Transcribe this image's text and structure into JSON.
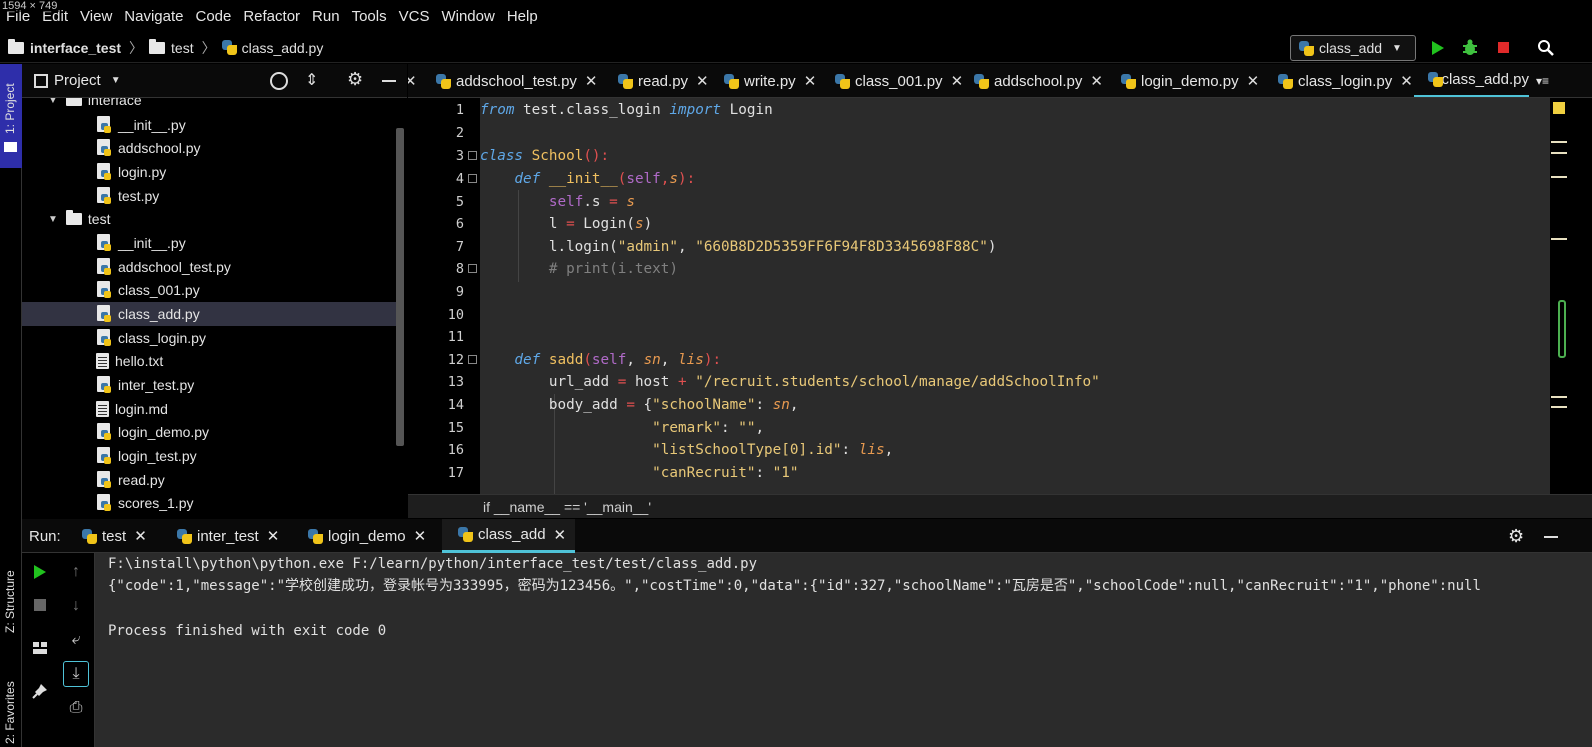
{
  "screen_label": "1594 × 749",
  "menu": [
    "File",
    "Edit",
    "View",
    "Navigate",
    "Code",
    "Refactor",
    "Run",
    "Tools",
    "VCS",
    "Window",
    "Help"
  ],
  "nav": {
    "project": "interface_test",
    "folder": "test",
    "file": "class_add.py"
  },
  "run_config": "class_add",
  "side_tabs": {
    "project": "1: Project",
    "structure": "Z: Structure",
    "favorites": "2: Favorites"
  },
  "project_panel": {
    "title": "Project",
    "tree": [
      {
        "label": "interface",
        "type": "folder",
        "expanded": true
      },
      {
        "label": "__init__.py",
        "type": "py"
      },
      {
        "label": "addschool.py",
        "type": "py"
      },
      {
        "label": "login.py",
        "type": "py"
      },
      {
        "label": "test.py",
        "type": "py"
      },
      {
        "label": "test",
        "type": "folder",
        "expanded": true
      },
      {
        "label": "__init__.py",
        "type": "py"
      },
      {
        "label": "addschool_test.py",
        "type": "py"
      },
      {
        "label": "class_001.py",
        "type": "py"
      },
      {
        "label": "class_add.py",
        "type": "py",
        "selected": true
      },
      {
        "label": "class_login.py",
        "type": "py"
      },
      {
        "label": "hello.txt",
        "type": "txt"
      },
      {
        "label": "inter_test.py",
        "type": "py"
      },
      {
        "label": "login.md",
        "type": "txt"
      },
      {
        "label": "login_demo.py",
        "type": "py"
      },
      {
        "label": "login_test.py",
        "type": "py"
      },
      {
        "label": "read.py",
        "type": "py"
      },
      {
        "label": "scores_1.py",
        "type": "py"
      }
    ]
  },
  "editor_tabs": [
    "addschool_test.py",
    "read.py",
    "write.py",
    "class_001.py",
    "addschool.py",
    "login_demo.py",
    "class_login.py",
    "class_add.py"
  ],
  "active_editor_tab": "class_add.py",
  "line_numbers": [
    "1",
    "2",
    "3",
    "4",
    "5",
    "6",
    "7",
    "8",
    "9",
    "10",
    "11",
    "12",
    "13",
    "14",
    "15",
    "16",
    "17"
  ],
  "code": {
    "l1_a": "from",
    "l1_b": " test.class_login ",
    "l1_c": "import",
    "l1_d": " Login",
    "l3_a": "class",
    "l3_b": " School",
    "l3_c": "():",
    "l4_a": "    def",
    "l4_b": " __init__",
    "l4_c": "(",
    "l4_d": "self",
    "l4_e": ",",
    "l4_f": "s",
    "l4_g": "):",
    "l5_a": "        ",
    "l5_b": "self",
    "l5_c": ".s ",
    "l5_d": "=",
    "l5_e": " ",
    "l5_f": "s",
    "l6_a": "        l ",
    "l6_b": "=",
    "l6_c": " Login(",
    "l6_d": "s",
    "l6_e": ")",
    "l7_a": "        l.login(",
    "l7_b": "\"admin\"",
    "l7_c": ", ",
    "l7_d": "\"660B8D2D5359FF6F94F8D3345698F88C\"",
    "l7_e": ")",
    "l8": "        # print(i.text)",
    "l12_a": "    def",
    "l12_b": " sadd",
    "l12_c": "(",
    "l12_d": "self",
    "l12_e": ", ",
    "l12_f": "sn",
    "l12_g": ", ",
    "l12_h": "lis",
    "l12_i": "):",
    "l13_a": "        url_add ",
    "l13_b": "=",
    "l13_c": " host ",
    "l13_d": "+",
    "l13_e": " ",
    "l13_f": "\"/recruit.students/school/manage/addSchoolInfo\"",
    "l14_a": "        body_add ",
    "l14_b": "=",
    "l14_c": " {",
    "l14_d": "\"schoolName\"",
    "l14_e": ": ",
    "l14_f": "sn",
    "l14_g": ",",
    "l15_a": "                    ",
    "l15_b": "\"remark\"",
    "l15_c": ": ",
    "l15_d": "\"\"",
    "l15_e": ",",
    "l16_a": "                    ",
    "l16_b": "\"listSchoolType[0].id\"",
    "l16_c": ": ",
    "l16_d": "lis",
    "l16_e": ",",
    "l17_a": "                    ",
    "l17_b": "\"canRecruit\"",
    "l17_c": ": ",
    "l17_d": "\"1\""
  },
  "editor_breadcrumb": "if __name__ == '__main__'",
  "run_panel": {
    "label": "Run:",
    "tabs": [
      "test",
      "inter_test",
      "login_demo",
      "class_add"
    ],
    "active_tab": "class_add",
    "output": [
      "F:\\install\\python\\python.exe F:/learn/python/interface_test/test/class_add.py",
      "{\"code\":1,\"message\":\"学校创建成功，登录帐号为333995，密码为123456。\",\"costTime\":0,\"data\":{\"id\":327,\"schoolName\":\"瓦房是否\",\"schoolCode\":null,\"canRecruit\":\"1\",\"phone\":null",
      "",
      "Process finished with exit code 0"
    ]
  },
  "colors": {
    "run_green": "#21c21e",
    "stop_red": "#e02a2a",
    "debug_green": "#3fc13f",
    "accent": "#4fc3d8"
  }
}
